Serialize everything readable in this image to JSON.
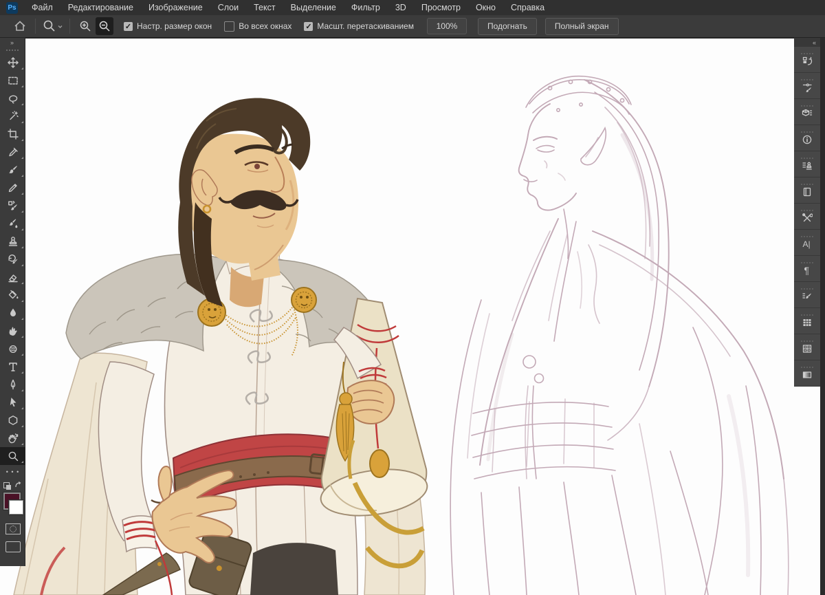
{
  "app": {
    "logo_text": "Ps"
  },
  "menubar": {
    "items": [
      "Файл",
      "Редактирование",
      "Изображение",
      "Слои",
      "Текст",
      "Выделение",
      "Фильтр",
      "3D",
      "Просмотр",
      "Окно",
      "Справка"
    ]
  },
  "options_bar": {
    "checkboxes": [
      {
        "label": "Настр. размер окон",
        "checked": true,
        "glyph": "✓"
      },
      {
        "label": "Во всех окнах",
        "checked": false,
        "glyph": ""
      },
      {
        "label": "Масшт. перетаскиванием",
        "checked": true,
        "glyph": "✓"
      }
    ],
    "zoom_value": "100%",
    "fit_button": "Подогнать",
    "fullscreen_button": "Полный экран"
  },
  "toolbar": {
    "collapse_glyph": "»",
    "more_tools_glyph": "• • •",
    "selected_tool": "Масштаб",
    "foreground_color": "#4a1126",
    "background_color": "#ffffff",
    "tools": [
      "Перемещение",
      "Прямоугольная область",
      "Лассо",
      "Волшебная палочка",
      "Рамка",
      "Пипетка",
      "Кисть",
      "Карандаш",
      "Замена цвета",
      "Микс-кисть",
      "Штамп",
      "Архивная кисть",
      "Ластик",
      "Заливка",
      "Размытие",
      "Палец",
      "Губка",
      "Текст",
      "Перо",
      "Выделение контура",
      "Фигура",
      "Рука",
      "Масштаб"
    ]
  },
  "panel_dock": {
    "collapse_glyph": "«",
    "panels": [
      "История",
      "Настройки кисти",
      "3D",
      "Инфо",
      "Источник клонов",
      "Библиотеки",
      "Наборы инструментов",
      "Символ",
      "Абзац",
      "Кисти",
      "Образцы",
      "Узоры",
      "Градиенты"
    ]
  },
  "canvas": {
    "zoom": "100%",
    "palette": {
      "skin": "#eac793",
      "hair": "#4c3a28",
      "fur": "#cbc5ba",
      "coat": "#f4eee3",
      "cape": "#eee5d2",
      "sash_red": "#c04545",
      "belt_brown": "#8a6a4c",
      "gold": "#d9a23a",
      "scroll": "#ebe1c6",
      "sketch_line": "#c3a9b6"
    }
  }
}
